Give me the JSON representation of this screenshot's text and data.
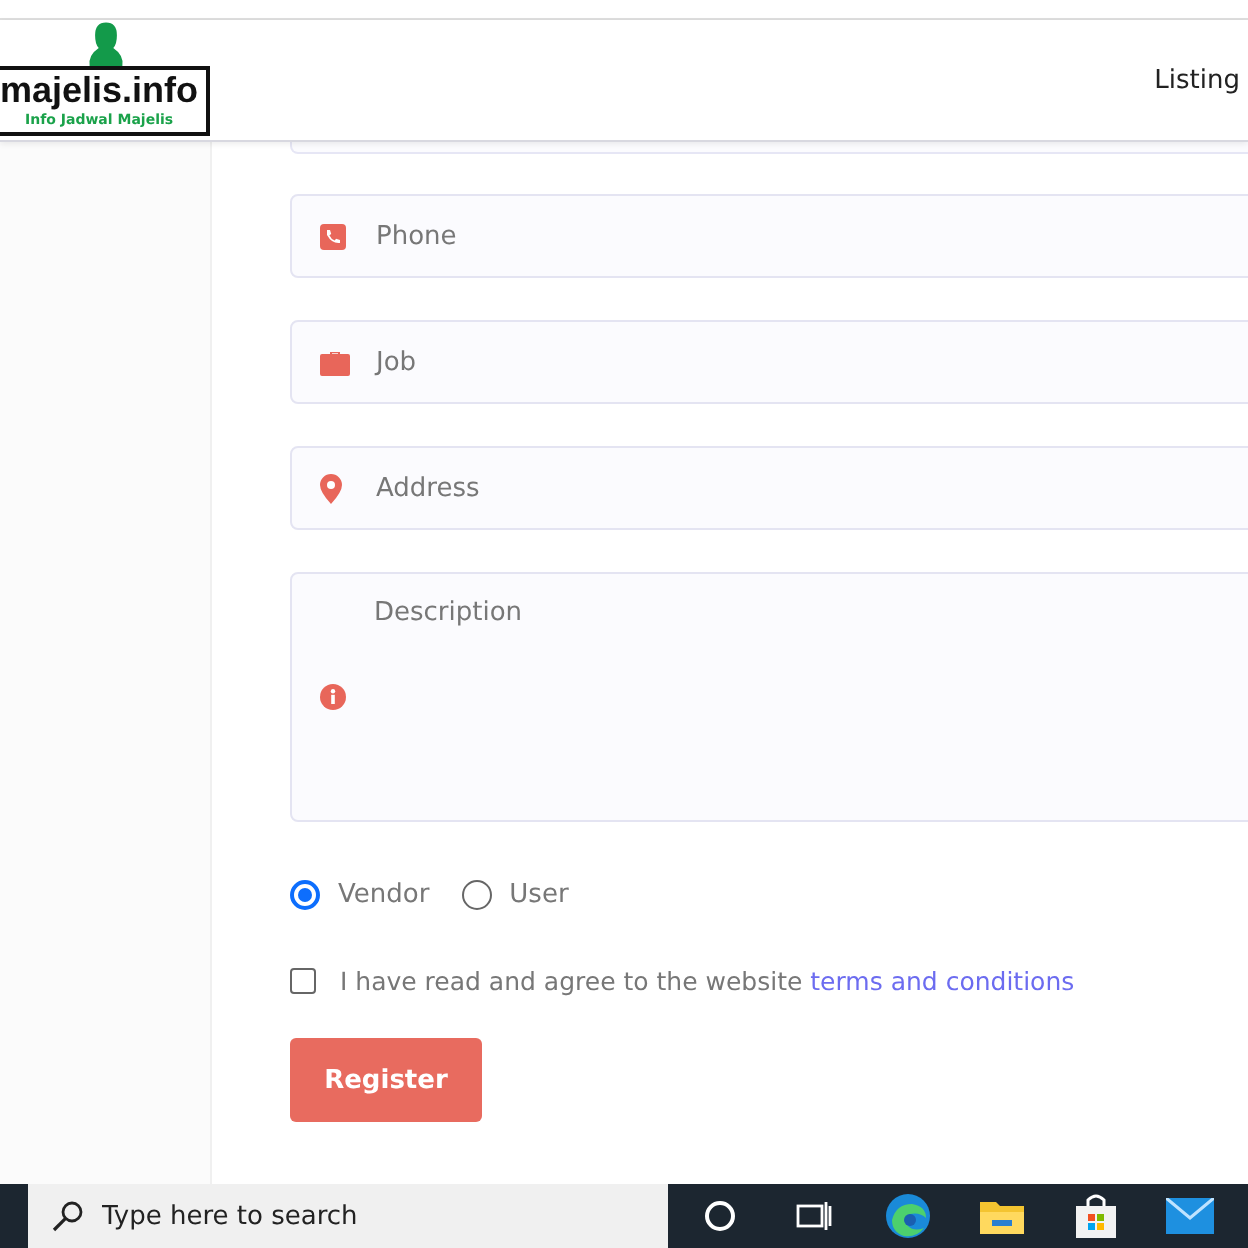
{
  "header": {
    "logo_title": "majelis.info",
    "logo_subtitle": "Info Jadwal Majelis",
    "nav": [
      "Listing"
    ]
  },
  "fields": [
    {
      "kind": "phone",
      "placeholder": "Phone"
    },
    {
      "kind": "job",
      "placeholder": "Job"
    },
    {
      "kind": "address",
      "placeholder": "Address"
    },
    {
      "kind": "description",
      "placeholder": "Description"
    }
  ],
  "roles": [
    {
      "label": "Vendor",
      "selected": true
    },
    {
      "label": "User",
      "selected": false
    }
  ],
  "agreement": {
    "checked": false,
    "text": "I have read and agree to the website",
    "link": "terms and conditions"
  },
  "submit": "Register",
  "taskbar": {
    "search_placeholder": "Type here to search"
  }
}
